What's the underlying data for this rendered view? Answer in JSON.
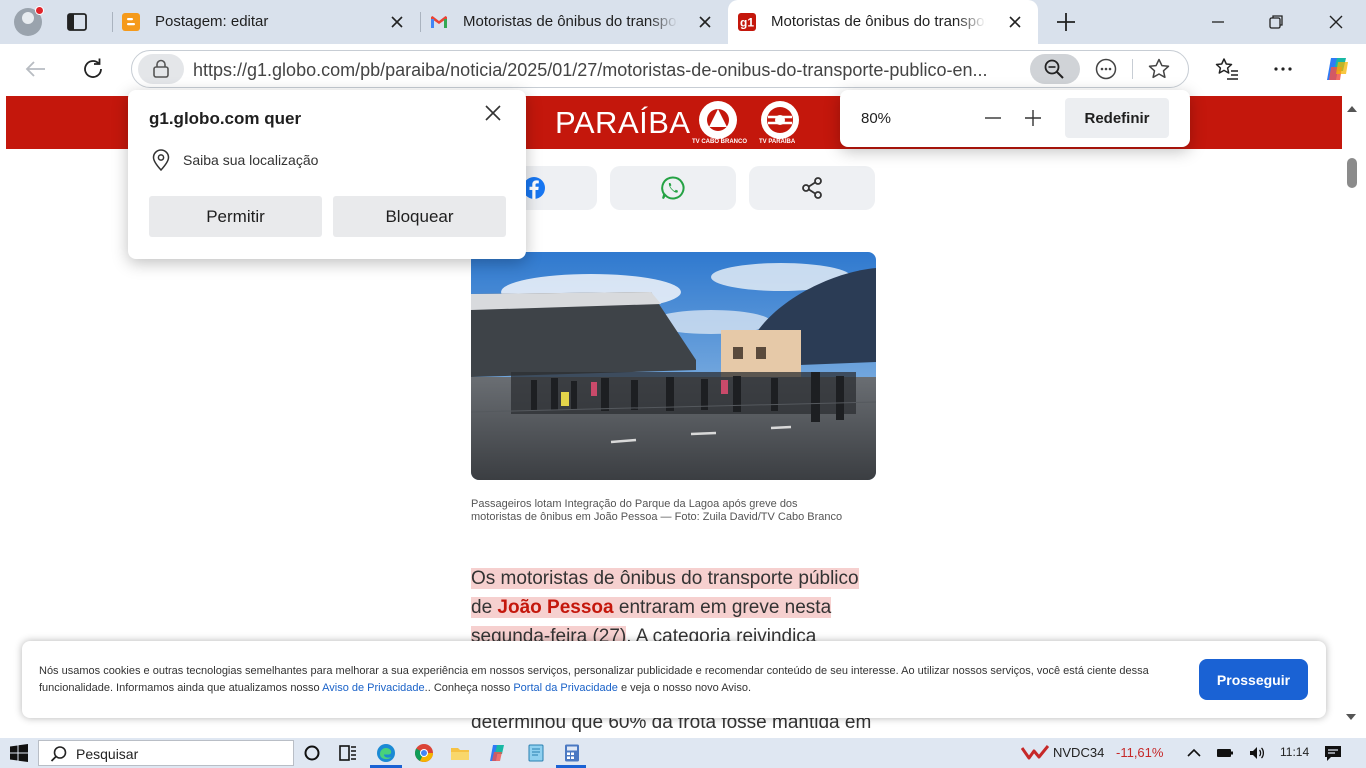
{
  "browser": {
    "tabs": [
      {
        "title": "Postagem: editar",
        "icon": "blogger-icon"
      },
      {
        "title": "Motoristas de ônibus do transporte",
        "icon": "gmail-icon"
      },
      {
        "title": "Motoristas de ônibus do transporte",
        "icon": "g1-icon",
        "favicon_text": "g1",
        "active": true
      }
    ],
    "url": "https://g1.globo.com/pb/paraiba/noticia/2025/01/27/motoristas-de-onibus-do-transporte-publico-en..."
  },
  "permission_popup": {
    "title": "g1.globo.com quer",
    "request": "Saiba sua localização",
    "allow_label": "Permitir",
    "block_label": "Bloquear"
  },
  "zoom_popup": {
    "value": "80%",
    "reset_label": "Redefinir"
  },
  "site": {
    "brand": "PARAÍBA",
    "logo1_caption": "TV CABO BRANCO",
    "logo2_caption": "TV PARAÍBA",
    "header_color": "#c4170c"
  },
  "article": {
    "photo_caption": "Passageiros lotam Integração do Parque da Lagoa após greve dos motoristas de ônibus em João Pessoa — Foto: Zuila David/TV Cabo Branco",
    "p1_a": "Os motoristas de ônibus do transporte público de ",
    "p1_link": "João Pessoa",
    "p1_b": " entraram em greve nesta segunda-feira (27)",
    "p1_c": ". A categoria reivindica",
    "p2": "determinou que 60% da frota fosse mantida em"
  },
  "cookie_banner": {
    "text_a": "Nós usamos cookies e outras tecnologias semelhantes para melhorar a sua experiência em nossos serviços, personalizar publicidade e recomendar conteúdo de seu interesse. Ao utilizar nossos serviços, você está ciente dessa funcionalidade. Informamos ainda que atualizamos nosso ",
    "link1": "Aviso de Privacidade",
    "text_b": ".. Conheça nosso ",
    "link2": "Portal da Privacidade",
    "text_c": " e veja o nosso novo Aviso.",
    "button_label": "Prosseguir"
  },
  "taskbar": {
    "search_placeholder": "Pesquisar",
    "ticker": "NVDC34",
    "change": "-11,61%",
    "time": "11:14"
  }
}
